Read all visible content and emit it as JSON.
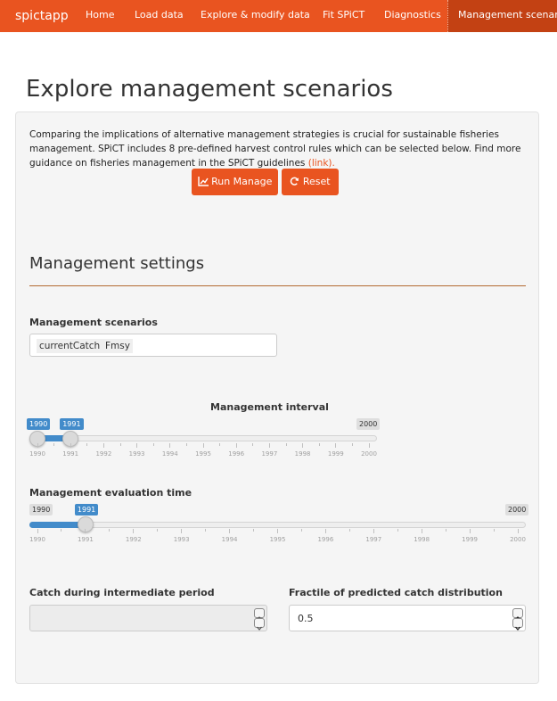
{
  "nav": {
    "brand": "spictapp",
    "items": [
      "Home",
      "Load data",
      "Explore & modify data",
      "Fit SPiCT",
      "Diagnostics"
    ],
    "active": "Management scenarios"
  },
  "page_title": "Explore management scenarios",
  "intro": {
    "line1": "Comparing the implications of alternative management strategies is crucial for sustainable fisheries",
    "line2": "management. SPiCT includes 8 pre-defined harvest control rules which can be selected below. Find more",
    "line3": "guidance on fisheries management in the SPiCT guidelines",
    "link": "(link)."
  },
  "buttons": {
    "run": "Run Manage",
    "reset": "Reset"
  },
  "section_title": "Management settings",
  "scenarios": {
    "label": "Management scenarios",
    "selected": [
      "currentCatch",
      "Fmsy"
    ]
  },
  "interval": {
    "label": "Management interval",
    "min": 1990,
    "max": 2000,
    "from": 1990,
    "to": 1991,
    "from_label": "1990",
    "to_label": "1991",
    "max_label": "2000",
    "ticks": [
      "1990",
      "1991",
      "1992",
      "1993",
      "1994",
      "1995",
      "1996",
      "1997",
      "1998",
      "1999",
      "2000"
    ]
  },
  "eval_time": {
    "label": "Management evaluation time",
    "min": 1990,
    "max": 2000,
    "value": 1991,
    "min_label": "1990",
    "value_label": "1991",
    "max_label": "2000",
    "ticks": [
      "1990",
      "1991",
      "1992",
      "1993",
      "1994",
      "1995",
      "1996",
      "1997",
      "1998",
      "1999",
      "2000"
    ]
  },
  "catch": {
    "label": "Catch during intermediate period",
    "value": ""
  },
  "fractile": {
    "label": "Fractile of predicted catch distribution",
    "value": "0.5"
  },
  "colors": {
    "accent": "#e95420",
    "slider": "#428bca"
  }
}
